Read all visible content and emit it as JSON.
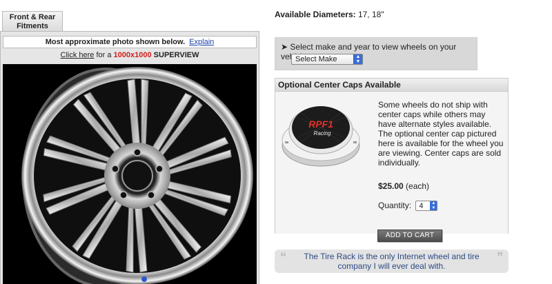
{
  "tab": {
    "label": "Front & Rear Fitments"
  },
  "photo_notice": {
    "text": "Most approximate photo shown below.",
    "link": "Explain"
  },
  "superview": {
    "link": "Click here",
    "middle": " for a ",
    "resolution": "1000x1000",
    "suffix": "SUPERVIEW"
  },
  "diameters": {
    "label": "Available Diameters:",
    "value": "17, 18\""
  },
  "vehicle_select": {
    "prompt": "Select make and year to view wheels on your vehicle:",
    "selected": "Select Make"
  },
  "center_caps": {
    "title": "Optional Center Caps Available",
    "logo_text": "RPF1",
    "logo_sub": "Racing",
    "description": "Some wheels do not ship with center caps while others may have alternate styles available. The optional center cap pictured here is available for the wheel you are viewing. Center caps are sold individually.",
    "price": "$25.00",
    "price_unit": " (each)",
    "quantity_label": "Quantity:",
    "quantity_value": "4",
    "add_to_cart": "ADD TO CART"
  },
  "testimonial": {
    "text": "The Tire Rack is the only Internet wheel and tire company I will ever deal with."
  },
  "colors": {
    "accent_red": "#d01c1c",
    "link_blue": "#1a3fa8",
    "quote_blue": "#2c4a85"
  }
}
